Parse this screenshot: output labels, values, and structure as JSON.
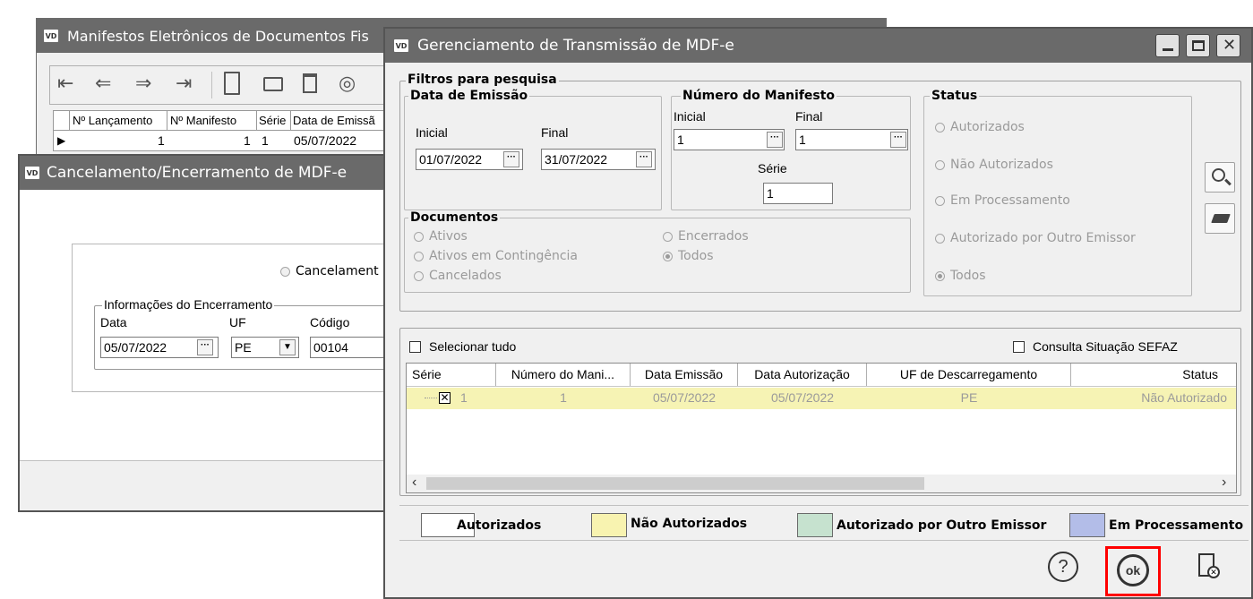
{
  "win1": {
    "title": "Manifestos Eletrônicos de Documentos Fis",
    "columns": [
      "Nº Lançamento",
      "Nº Manifesto",
      "Série",
      "Data de Emissã"
    ],
    "row": {
      "lancamento": "1",
      "manifesto": "1",
      "serie": "1",
      "data": "05/07/2022"
    }
  },
  "win2": {
    "title": "Cancelamento/Encerramento de MDF-e",
    "option_cancel": "Cancelament",
    "group_title": "Informações do Encerramento",
    "data_label": "Data",
    "uf_label": "UF",
    "codigo_label": "Código",
    "data_value": "05/07/2022",
    "uf_value": "PE",
    "codigo_value": "00104"
  },
  "main": {
    "title": "Gerenciamento de Transmissão de MDF-e",
    "filtros_title": "Filtros para pesquisa",
    "emissao": {
      "title": "Data de Emissão",
      "inicial_label": "Inicial",
      "final_label": "Final",
      "inicial_value": "01/07/2022",
      "final_value": "31/07/2022"
    },
    "numero": {
      "title": "Número do Manifesto",
      "inicial_label": "Inicial",
      "final_label": "Final",
      "inicial_value": "1",
      "final_value": "1",
      "serie_label": "Série",
      "serie_value": "1"
    },
    "documentos": {
      "title": "Documentos",
      "ativos": "Ativos",
      "ativos_contingencia": "Ativos em Contingência",
      "cancelados": "Cancelados",
      "encerrados": "Encerrados",
      "todos": "Todos"
    },
    "status": {
      "title": "Status",
      "autorizados": "Autorizados",
      "nao_autorizados": "Não Autorizados",
      "em_processamento": "Em Processamento",
      "autorizado_outro": "Autorizado por Outro Emissor",
      "todos": "Todos"
    },
    "selecionar_tudo": "Selecionar tudo",
    "consulta_sefaz": "Consulta Situação SEFAZ",
    "grid": {
      "headers": [
        "Série",
        "Número do Mani...",
        "Data Emissão",
        "Data Autorização",
        "UF de Descarregamento",
        "Status"
      ],
      "row": {
        "serie": "1",
        "numero": "1",
        "emissao": "05/07/2022",
        "autorizacao": "05/07/2022",
        "uf": "PE",
        "status": "Não Autorizado"
      }
    },
    "legend": {
      "autorizados": "Autorizados",
      "nao_autorizados": "Não Autorizados",
      "autorizado_outro": "Autorizado por Outro Emissor",
      "em_processamento": "Em Processamento"
    },
    "ok_label": "ok"
  },
  "colors": {
    "titlebar": "#6a6a6a",
    "row_highlight": "#f6f3b4",
    "legend_autorizados": "#ffffff",
    "legend_nao_autorizados": "#f8f3b0",
    "legend_outro_emissor": "#c6e2cf",
    "legend_em_processamento": "#b3bde8",
    "ok_highlight": "#ff0000"
  }
}
